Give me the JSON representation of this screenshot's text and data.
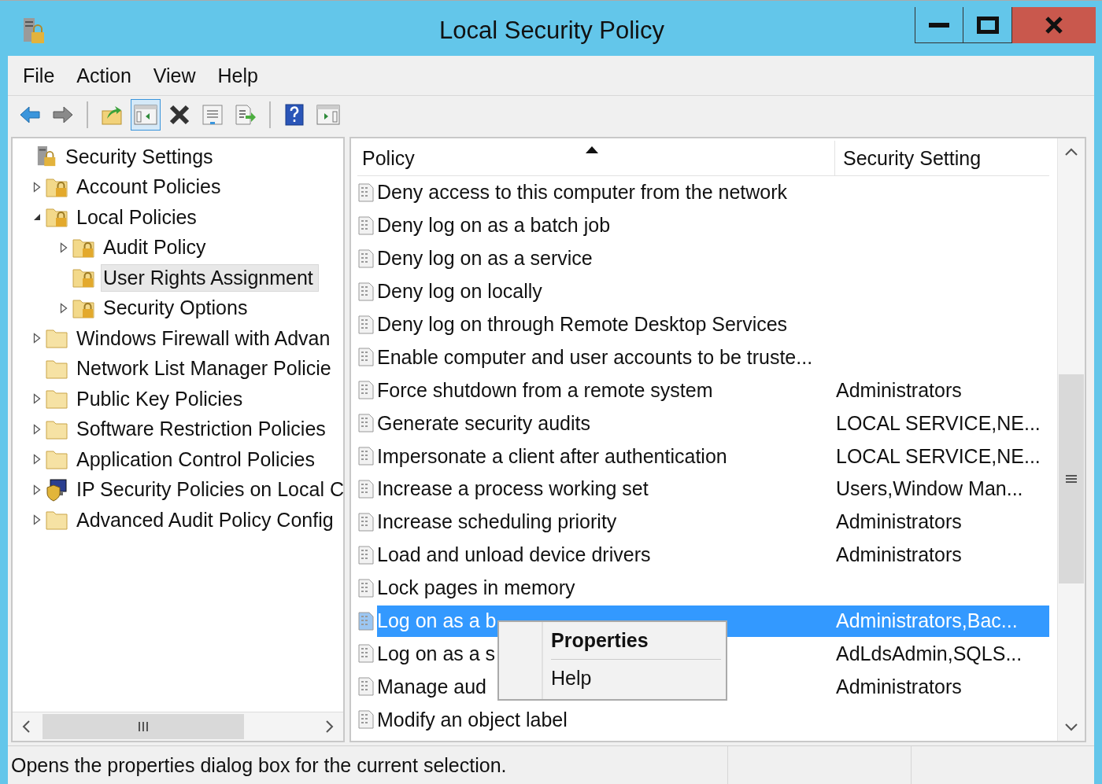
{
  "window": {
    "title": "Local Security Policy"
  },
  "menu": [
    "File",
    "Action",
    "View",
    "Help"
  ],
  "toolbar": [
    {
      "kind": "back",
      "pressed": false
    },
    {
      "kind": "forward",
      "pressed": false
    },
    {
      "kind": "sep"
    },
    {
      "kind": "up",
      "pressed": false
    },
    {
      "kind": "tree",
      "pressed": true
    },
    {
      "kind": "delete",
      "pressed": false
    },
    {
      "kind": "properties",
      "pressed": false
    },
    {
      "kind": "export",
      "pressed": false
    },
    {
      "kind": "sep"
    },
    {
      "kind": "help",
      "pressed": false
    },
    {
      "kind": "actions",
      "pressed": false
    }
  ],
  "tree": [
    {
      "label": "Security Settings",
      "kind": "root",
      "selected": false,
      "children": [
        {
          "label": "Account Policies",
          "kind": "policy",
          "expanded": false,
          "selected": false
        },
        {
          "label": "Local Policies",
          "kind": "policy",
          "expanded": true,
          "selected": false,
          "children": [
            {
              "label": "Audit Policy",
              "kind": "policy",
              "expanded": false,
              "selected": false
            },
            {
              "label": "User Rights Assignment",
              "kind": "policy",
              "selected": true
            },
            {
              "label": "Security Options",
              "kind": "policy",
              "expanded": false,
              "selected": false
            }
          ]
        },
        {
          "label": "Windows Firewall with Advan",
          "kind": "folder",
          "expanded": false,
          "selected": false
        },
        {
          "label": "Network List Manager Policie",
          "kind": "folder",
          "selected": false
        },
        {
          "label": "Public Key Policies",
          "kind": "folder",
          "expanded": false,
          "selected": false
        },
        {
          "label": "Software Restriction Policies",
          "kind": "folder",
          "expanded": false,
          "selected": false
        },
        {
          "label": "Application Control Policies",
          "kind": "folder",
          "expanded": false,
          "selected": false
        },
        {
          "label": "IP Security Policies on Local C",
          "kind": "ipsec",
          "expanded": false,
          "selected": false
        },
        {
          "label": "Advanced Audit Policy Config",
          "kind": "folder",
          "expanded": false,
          "selected": false
        }
      ]
    }
  ],
  "table": {
    "columns": [
      "Policy",
      "Security Setting"
    ],
    "rows": [
      {
        "policy": "Deny access to this computer from the network",
        "selected": false
      },
      {
        "policy": "Deny log on as a batch job",
        "selected": false
      },
      {
        "policy": "Deny log on as a service",
        "selected": false
      },
      {
        "policy": "Deny log on locally",
        "selected": false
      },
      {
        "policy": "Deny log on through Remote Desktop Services",
        "selected": false
      },
      {
        "policy": "Enable computer and user accounts to be truste...",
        "selected": false
      },
      {
        "policy": "Force shutdown from a remote system",
        "setting": "Administrators",
        "selected": false
      },
      {
        "policy": "Generate security audits",
        "setting": "LOCAL SERVICE,NE...",
        "selected": false
      },
      {
        "policy": "Impersonate a client after authentication",
        "setting": "LOCAL SERVICE,NE...",
        "selected": false
      },
      {
        "policy": "Increase a process working set",
        "setting": "Users,Window Man...",
        "selected": false
      },
      {
        "policy": "Increase scheduling priority",
        "setting": "Administrators",
        "selected": false
      },
      {
        "policy": "Load and unload device drivers",
        "setting": "Administrators",
        "selected": false
      },
      {
        "policy": "Lock pages in memory",
        "selected": false
      },
      {
        "policy": "Log on as a b",
        "setting": "Administrators,Bac...",
        "selected": true
      },
      {
        "policy": "Log on as a s",
        "setting": "AdLdsAdmin,SQLS...",
        "selected": false
      },
      {
        "policy": "Manage aud",
        "setting": "Administrators",
        "selected": false
      },
      {
        "policy": "Modify an object label",
        "selected": false
      }
    ]
  },
  "context_menu": [
    {
      "label": "Properties",
      "default": true
    },
    {
      "label": "Help",
      "default": false
    }
  ],
  "status_bar": "Opens the properties dialog box for the current selection."
}
